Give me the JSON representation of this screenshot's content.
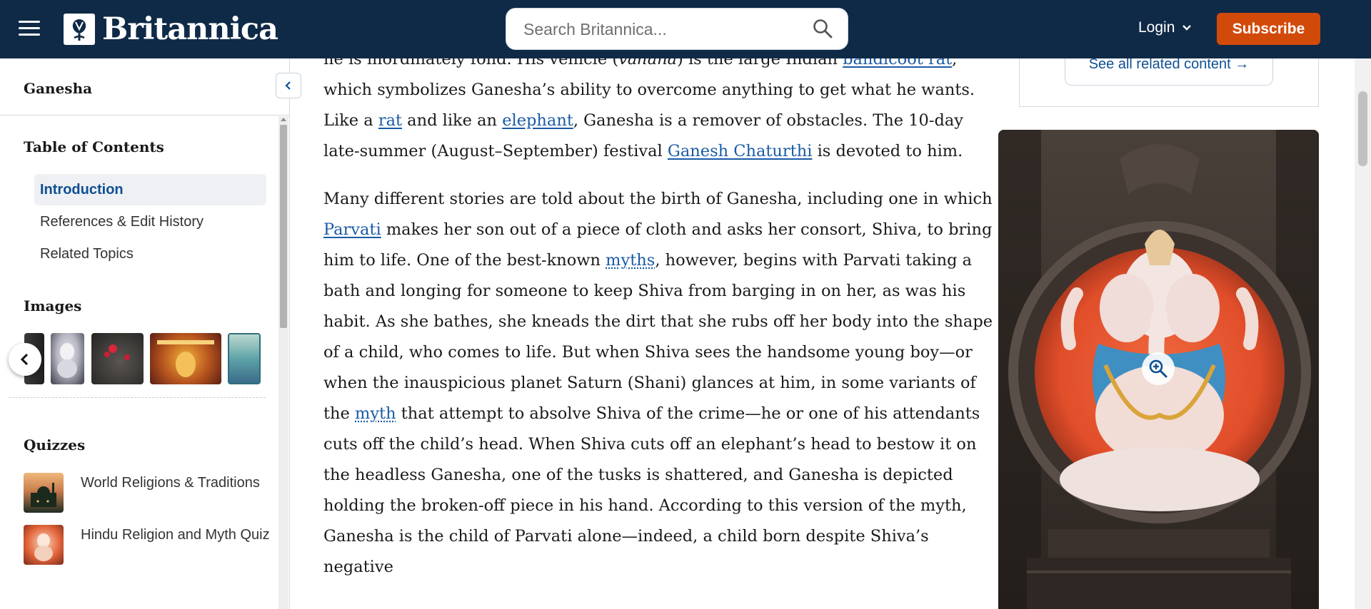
{
  "header": {
    "brand": "Britannica",
    "search_placeholder": "Search Britannica...",
    "login_label": "Login",
    "subscribe_label": "Subscribe",
    "colors": {
      "bar": "#0f2a47",
      "subscribe": "#d24a0a"
    }
  },
  "sidebar": {
    "title": "Ganesha",
    "toc_heading": "Table of Contents",
    "toc_items": [
      {
        "label": "Introduction",
        "active": true
      },
      {
        "label": "References & Edit History",
        "active": false
      },
      {
        "label": "Related Topics",
        "active": false
      }
    ],
    "images_heading": "Images",
    "quizzes_heading": "Quizzes",
    "quizzes": [
      {
        "label": "World Religions & Traditions"
      },
      {
        "label": "Hindu Religion and Myth Quiz"
      }
    ]
  },
  "article": {
    "p1": {
      "t1": "he is inordinately fond. His vehicle (",
      "t1i": "vahana",
      "t2": ") is the large Indian ",
      "l1": "bandicoot rat",
      "t3": ", which symbolizes Ganesha’s ability to overcome anything to get what he wants. Like a ",
      "l2": "rat",
      "t4": " and like an ",
      "l3": "elephant",
      "t5": ", Ganesha is a remover of obstacles. The 10-day late-summer (August–September) festival ",
      "l4": "Ganesh Chaturthi",
      "t6": " is devoted to him."
    },
    "p2": {
      "t1": "Many different stories are told about the birth of Ganesha, including one in which ",
      "l1": "Parvati",
      "t2": " makes her son out of a piece of cloth and asks her consort, Shiva, to bring him to life. One of the best-known ",
      "l2": "myths",
      "t3": ", however, begins with Parvati taking a bath and longing for someone to keep Shiva from barging in on her, as was his habit. As she bathes, she kneads the dirt that she rubs off her body into the shape of a child, who comes to life. But when Shiva sees the handsome young boy—or when the inauspicious planet Saturn (Shani) glances at him, in some variants of the ",
      "l3": "myth",
      "t4": " that attempt to absolve Shiva of the crime—he or one of his attendants cuts off the child’s head. When Shiva cuts off an elephant’s head to bestow it on the headless Ganesha, one of the tusks is shattered, and Ganesha is depicted holding the broken-off piece in his hand. According to this version of the myth, Ganesha is the child of Parvati alone—indeed, a child born despite Shiva’s negative"
    }
  },
  "related": {
    "see_all_label": "See all related content →"
  },
  "icons": {
    "menu": "hamburger-icon",
    "search": "search-icon",
    "login_caret": "chevron-down-icon",
    "collapse": "chevron-left-icon",
    "carousel_prev": "chevron-left-icon",
    "zoom": "zoom-in-icon"
  }
}
